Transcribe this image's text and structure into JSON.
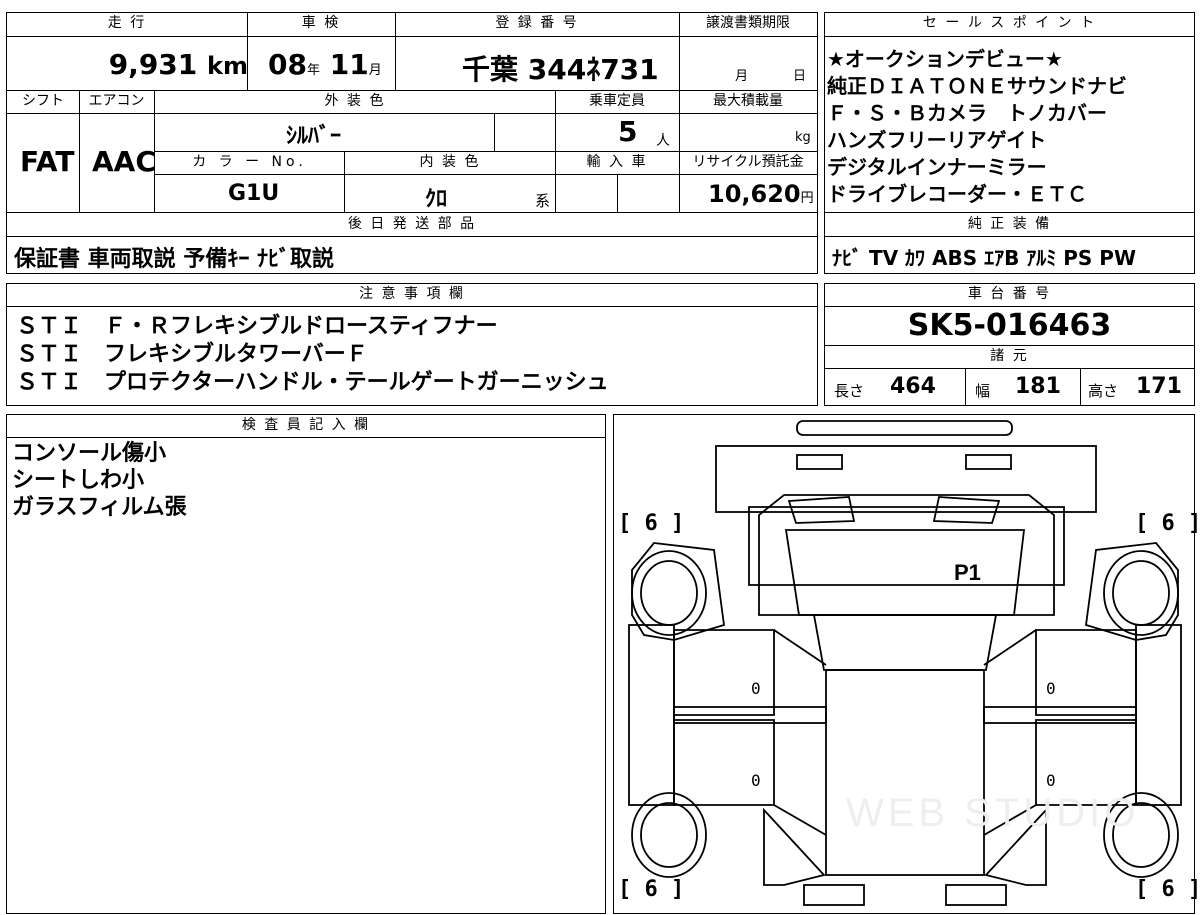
{
  "vehicle": {
    "header_mileage": "走 行",
    "header_inspection": "車 検",
    "header_registration": "登 録 番 号",
    "header_transfer": "譲渡書類期限",
    "mileage_value": "9,931",
    "mileage_unit": "km",
    "inspection_year": "08",
    "year_unit": "年",
    "inspection_month": "11",
    "month_unit": "月",
    "registration_number": "千葉 344ﾈ731",
    "transfer_month_unit": "月",
    "transfer_day_unit": "日",
    "header_shift": "シフト",
    "header_aircon": "エアコン",
    "header_exterior_color": "外 装 色",
    "header_capacity": "乗車定員",
    "header_max_load": "最大積載量",
    "shift_value": "FAT",
    "aircon_value": "AAC",
    "exterior_color_value": "ｼﾙﾊﾞｰ",
    "capacity_value": "5",
    "capacity_unit": "人",
    "max_load_unit": "kg",
    "header_color_no": "カ ラ ー No.",
    "header_interior_color": "内 装 色",
    "header_import": "輸 入 車",
    "header_recycle": "リサイクル預託金",
    "color_no_value": "G1U",
    "interior_color_value": "ｸﾛ",
    "interior_suffix": "系",
    "recycle_value": "10,620",
    "recycle_unit": "円",
    "header_later_parts": "後 日 発 送 部 品",
    "later_parts_value": "保証書 車両取説 予備ｷｰ ﾅﾋﾞ取説"
  },
  "sales_points": {
    "header": "セ ー ル ス ポ イ ン ト",
    "lines": [
      "★オークションデビュー★",
      "純正ＤＩＡＴＯＮＥサウンドナビ",
      "Ｆ・Ｓ・Ｂカメラ　トノカバー",
      "ハンズフリーリアゲイト",
      "デジタルインナーミラー",
      "ドライブレコーダー・ＥＴＣ"
    ]
  },
  "equipment": {
    "header": "純 正 装 備",
    "value": "ﾅﾋﾞ TV ｶﾜ ABS ｴｱB ｱﾙﾐ PS PW"
  },
  "notes": {
    "header": "注 意 事 項 欄",
    "lines": [
      "ＳＴＩ　Ｆ・Ｒフレキシブルドロースティフナー",
      "ＳＴＩ　フレキシブルタワーバーＦ",
      "ＳＴＩ　プロテクターハンドル・テールゲートガーニッシュ"
    ]
  },
  "chassis": {
    "header": "車 台 番 号",
    "value": "SK5-016463",
    "specs_header": "諸 元",
    "length_label": "長さ",
    "length_value": "464",
    "width_label": "幅",
    "width_value": "181",
    "height_label": "高さ",
    "height_value": "171"
  },
  "inspector": {
    "header": "検 査 員 記 入 欄",
    "lines": [
      "コンソール傷小",
      "シートしわ小",
      "ガラスフィルム張"
    ]
  },
  "diagram": {
    "tire_tl": "[ 6 ]",
    "tire_tr": "[ 6 ]",
    "tire_bl": "[ 6 ]",
    "tire_br": "[ 6 ]",
    "mark_p1": "P1",
    "zero_1": "0",
    "zero_2": "0",
    "zero_3": "0",
    "zero_4": "0",
    "watermark": "WEB STUDIO"
  }
}
